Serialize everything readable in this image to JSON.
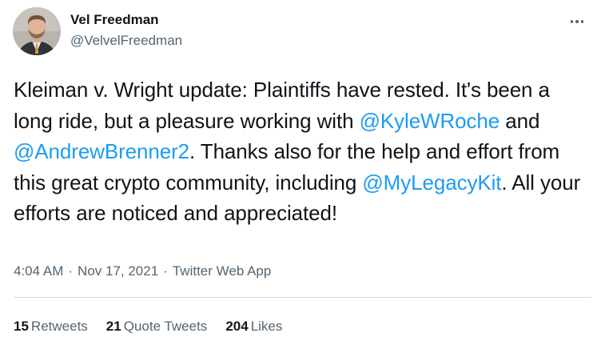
{
  "author": {
    "display_name": "Vel Freedman",
    "handle": "@VelvelFreedman"
  },
  "tweet": {
    "segments": [
      {
        "text": "Kleiman v. Wright update: Plaintiffs have rested. It's been a long ride, but a pleasure working with ",
        "type": "text"
      },
      {
        "text": "@KyleWRoche",
        "type": "mention"
      },
      {
        "text": " and ",
        "type": "text"
      },
      {
        "text": "@AndrewBrenner2",
        "type": "mention"
      },
      {
        "text": ". Thanks also for the help and effort from this great crypto community, including ",
        "type": "text"
      },
      {
        "text": "@MyLegacyKit",
        "type": "mention"
      },
      {
        "text": ". All your efforts are noticed and appreciated!",
        "type": "text"
      }
    ]
  },
  "meta": {
    "time": "4:04 AM",
    "date": "Nov 17, 2021",
    "app": "Twitter Web App",
    "separator": "·"
  },
  "stats": {
    "retweets": {
      "count": "15",
      "label": "Retweets"
    },
    "quote_tweets": {
      "count": "21",
      "label": "Quote Tweets"
    },
    "likes": {
      "count": "204",
      "label": "Likes"
    }
  },
  "colors": {
    "link": "#1d9bf0",
    "secondary_text": "#536471",
    "primary_text": "#0f1419",
    "divider": "#cfd9de"
  },
  "icons": {
    "more": "more-horizontal-icon"
  }
}
